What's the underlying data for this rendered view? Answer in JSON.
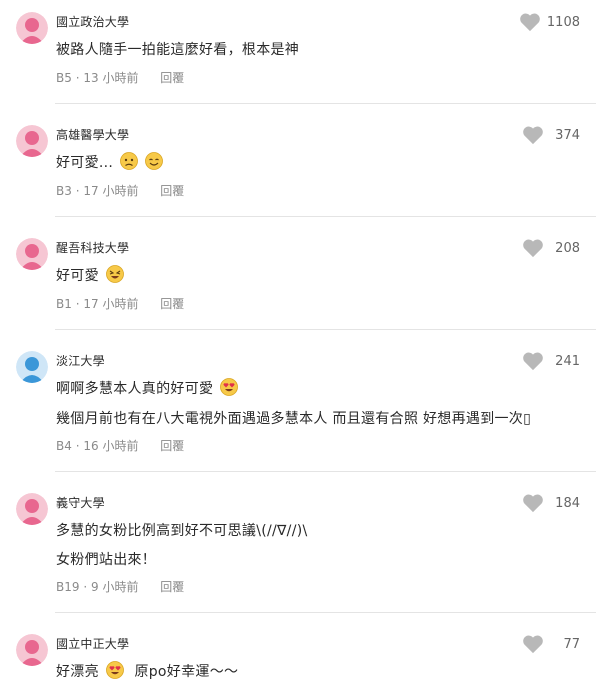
{
  "comments": [
    {
      "school": "國立政治大學",
      "likes": "1108",
      "avatar_color": "#ec7fa0",
      "lines": [
        "被路人隨手一拍能這麼好看，根本是神"
      ],
      "floor": "B5",
      "time": "13 小時前",
      "reply": "回覆"
    },
    {
      "school": "高雄醫學大學",
      "likes": "374",
      "avatar_color": "#ec7fa0",
      "lines": [
        "好可愛..."
      ],
      "floor": "B3",
      "time": "17 小時前",
      "reply": "回覆"
    },
    {
      "school": "醒吾科技大學",
      "likes": "208",
      "avatar_color": "#ec7fa0",
      "lines": [
        "好可愛"
      ],
      "floor": "B1",
      "time": "17 小時前",
      "reply": "回覆"
    },
    {
      "school": "淡江大學",
      "likes": "241",
      "avatar_color": "#4aa3df",
      "lines": [
        "啊啊多慧本人真的好可愛",
        "幾個月前也有在八大電視外面遇過多慧本人 而且還有合照 好想再遇到一次▯"
      ],
      "floor": "B4",
      "time": "16 小時前",
      "reply": "回覆"
    },
    {
      "school": "義守大學",
      "likes": "184",
      "avatar_color": "#ec7fa0",
      "lines": [
        "多慧的女粉比例高到好不可思議\\(//∇//)\\",
        "女粉們站出來！"
      ],
      "floor": "B19",
      "time": "9 小時前",
      "reply": "回覆"
    },
    {
      "school": "國立中正大學",
      "likes": "77",
      "avatar_color": "#ec7fa0",
      "lines": [
        "好漂亮",
        "原po好幸運～～"
      ],
      "floor": "",
      "time": "",
      "reply": ""
    }
  ],
  "separator": "·",
  "icons": {
    "like": "heart-icon",
    "avatar": "person-avatar-icon"
  },
  "colors": {
    "heart": "#b8b8b8",
    "meta": "#8a8a8a"
  }
}
